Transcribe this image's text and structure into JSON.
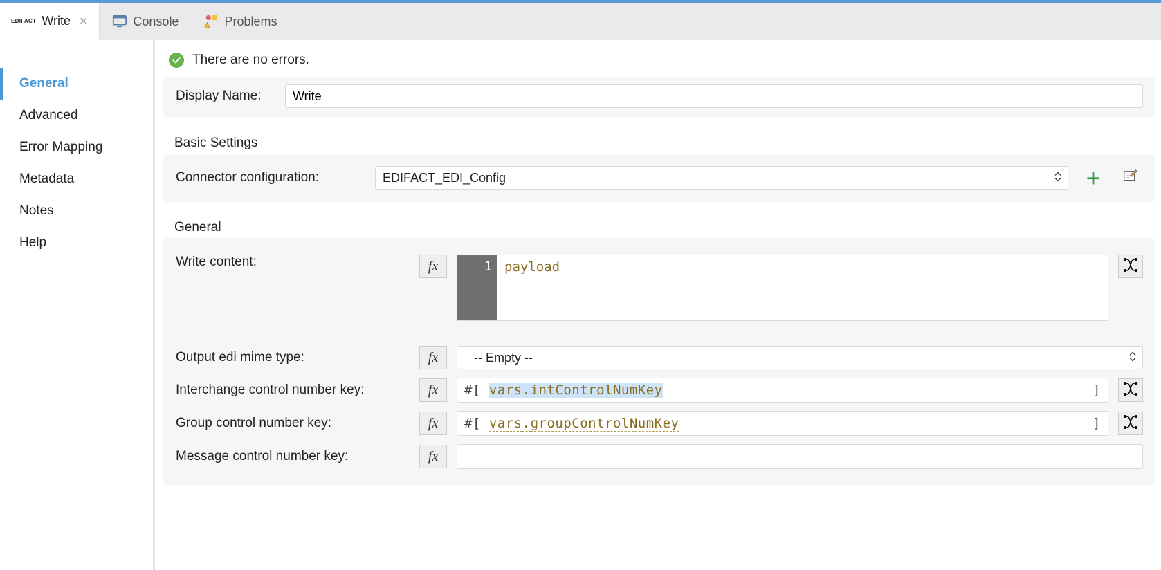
{
  "topbar": {
    "active_tab": {
      "badge": "EDIFACT",
      "title": "Write",
      "close_glyph": "✕"
    },
    "tools": [
      {
        "id": "console",
        "label": "Console"
      },
      {
        "id": "problems",
        "label": "Problems"
      }
    ]
  },
  "sidebar": {
    "items": [
      {
        "id": "general",
        "label": "General",
        "active": true
      },
      {
        "id": "advanced",
        "label": "Advanced"
      },
      {
        "id": "error-mapping",
        "label": "Error Mapping"
      },
      {
        "id": "metadata",
        "label": "Metadata"
      },
      {
        "id": "notes",
        "label": "Notes"
      },
      {
        "id": "help",
        "label": "Help"
      }
    ]
  },
  "status": {
    "text": "There are no errors."
  },
  "display_name": {
    "label": "Display Name:",
    "value": "Write"
  },
  "basic_settings": {
    "title": "Basic Settings",
    "connector_label": "Connector configuration:",
    "connector_value": "EDIFACT_EDI_Config"
  },
  "general": {
    "title": "General",
    "fields": {
      "write_content": {
        "label": "Write content:",
        "line_number": "1",
        "code": "payload"
      },
      "output_mime": {
        "label": "Output edi mime type:",
        "value": "-- Empty --"
      },
      "interchange_key": {
        "label": "Interchange control number key:",
        "prefix": "#[",
        "vars": "vars",
        "dot": ".",
        "name": "intControlNumKey",
        "suffix": "]"
      },
      "group_key": {
        "label": "Group control number key:",
        "prefix": "#[",
        "vars": "vars",
        "dot": ".",
        "name": "groupControlNumKey",
        "suffix": "]"
      },
      "message_key": {
        "label": "Message control number key:",
        "value": ""
      }
    }
  },
  "glyphs": {
    "fx": "fx"
  }
}
